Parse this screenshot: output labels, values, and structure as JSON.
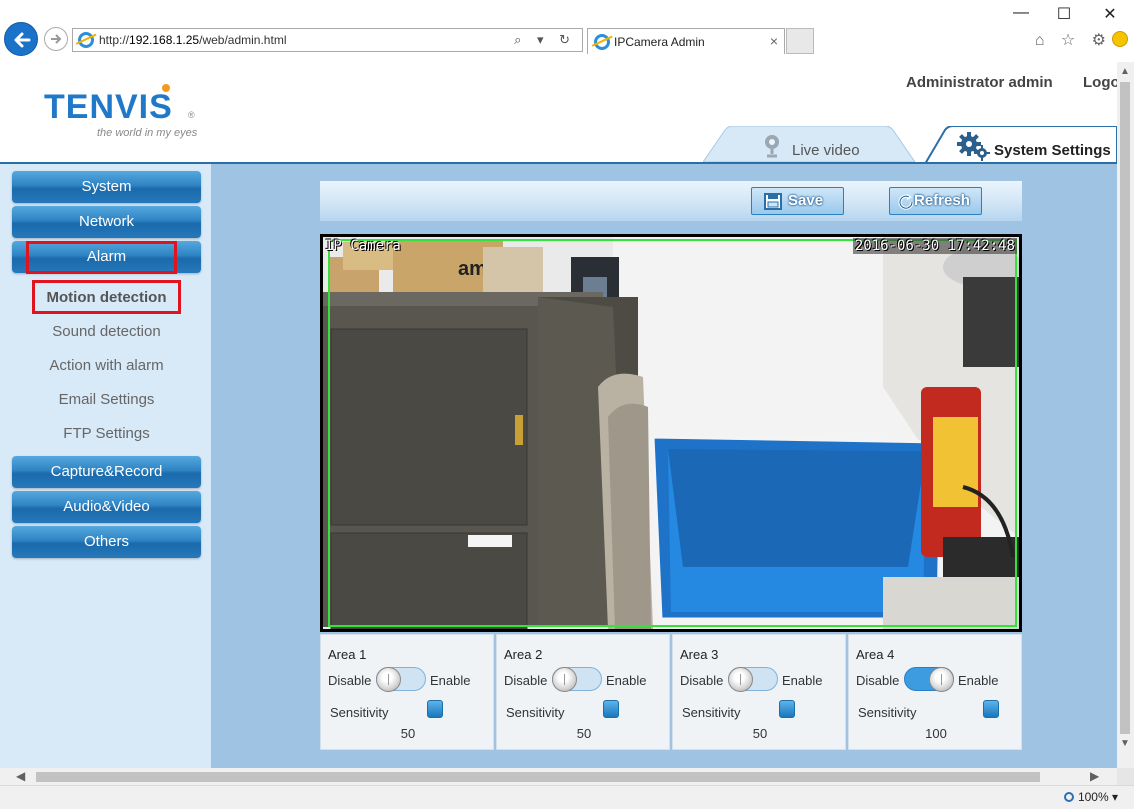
{
  "browser": {
    "url_prefix": "http://",
    "url_host": "192.168.1.25",
    "url_path": "/web/admin.html",
    "tab_title": "IPCamera Admin",
    "tab_close": "×",
    "zoom": "100%",
    "address_tools": "⌕ ▾ ↻",
    "window_minimize": "—",
    "window_maximize": "☐",
    "window_close": "✕",
    "right_icons": "⌂ ☆ ⚙"
  },
  "header": {
    "logo_text": "TENVIS",
    "logo_tagline": "the world in my eyes",
    "logo_registered": "®",
    "user_label": "Administrator admin",
    "logout_label": "Logo",
    "tabs": [
      {
        "label": "Live video",
        "icon": "webcam-icon",
        "active": false
      },
      {
        "label": "System Settings",
        "icon": "gear-icon",
        "active": true
      }
    ]
  },
  "sidebar": {
    "groups": [
      {
        "label": "System"
      },
      {
        "label": "Network"
      },
      {
        "label": "Alarm"
      }
    ],
    "alarm_items": [
      {
        "label": "Motion detection",
        "active": true
      },
      {
        "label": "Sound detection",
        "active": false
      },
      {
        "label": "Action with alarm",
        "active": false
      },
      {
        "label": "Email Settings",
        "active": false
      },
      {
        "label": "FTP Settings",
        "active": false
      }
    ],
    "groups_bottom": [
      {
        "label": "Capture&Record"
      },
      {
        "label": "Audio&Video"
      },
      {
        "label": "Others"
      }
    ]
  },
  "toolbar": {
    "save_label": "Save",
    "refresh_label": "Refresh"
  },
  "video": {
    "osd_name": "IP Camera",
    "osd_timestamp": "2016-06-30 17:42:48",
    "detection_box_color": "#35e23b",
    "scene_text": "amazon"
  },
  "areas": [
    {
      "title": "Area 1",
      "disable_label": "Disable",
      "enable_label": "Enable",
      "enabled": false,
      "sensitivity_label": "Sensitivity",
      "sensitivity": 50,
      "sensitivity_max": 100
    },
    {
      "title": "Area 2",
      "disable_label": "Disable",
      "enable_label": "Enable",
      "enabled": false,
      "sensitivity_label": "Sensitivity",
      "sensitivity": 50,
      "sensitivity_max": 100
    },
    {
      "title": "Area 3",
      "disable_label": "Disable",
      "enable_label": "Enable",
      "enabled": false,
      "sensitivity_label": "Sensitivity",
      "sensitivity": 50,
      "sensitivity_max": 100
    },
    {
      "title": "Area 4",
      "disable_label": "Disable",
      "enable_label": "Enable",
      "enabled": true,
      "sensitivity_label": "Sensitivity",
      "sensitivity": 100,
      "sensitivity_max": 100
    }
  ],
  "colors": {
    "accent_blue": "#2e83c3",
    "highlight_red": "#e0141e",
    "panel_bg": "#9fc3e2"
  }
}
